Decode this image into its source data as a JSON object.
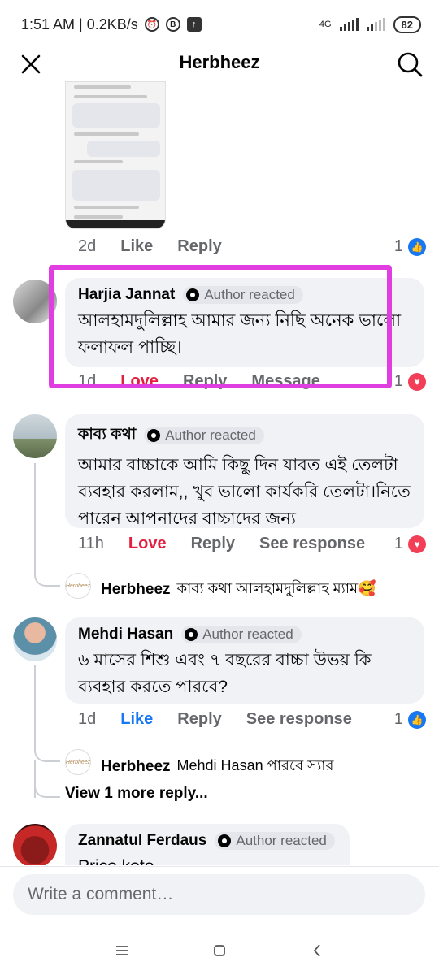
{
  "status_bar": {
    "time_speed": "1:51 AM | 0.2KB/s",
    "net": "4G",
    "battery": "82"
  },
  "header": {
    "title": "Herbheez"
  },
  "first_comment_meta": {
    "time": "2d",
    "like": "Like",
    "reply": "Reply",
    "react_count": "1"
  },
  "comments": [
    {
      "name": "Harjia Jannat",
      "badge": "Author reacted",
      "text": "আলহামদুলিল্লাহ আমার জন্য নিছি অনেক ভালো ফলাফল পাচ্ছি।",
      "time": "1d",
      "react_label": "Love",
      "reply": "Reply",
      "extra": "Message",
      "react_count": "1"
    },
    {
      "name": "কাব্য কথা",
      "badge": "Author reacted",
      "text": "আমার বাচ্চাকে আমি কিছু দিন যাবত এই তেলটা ব্যবহার করলাম,, খুব ভালো কার্যকরি তেলটা।নিতে পারেন আপনাদের বাচ্চাদের জন্য",
      "time": "11h",
      "react_label": "Love",
      "reply": "Reply",
      "extra": "See response",
      "react_count": "1",
      "page_reply": {
        "logo": "Herbheez",
        "name": "Herbheez",
        "text": "কাব্য কথা আলহামদুলিল্লাহ ম্যাম🥰"
      }
    },
    {
      "name": "Mehdi Hasan",
      "badge": "Author reacted",
      "text": "৬ মাসের শিশু এবং ৭ বছরের বাচ্চা উভয় কি ব্যবহার করতে পারবে?",
      "time": "1d",
      "react_label": "Like",
      "reply": "Reply",
      "extra": "See response",
      "react_count": "1",
      "page_reply": {
        "logo": "Herbheez",
        "name": "Herbheez",
        "text": "Mehdi Hasan পারবে স্যার"
      },
      "view_more": "View 1 more reply..."
    },
    {
      "name": "Zannatul Ferdaus",
      "badge": "Author reacted",
      "text": "Price koto"
    }
  ],
  "composer": {
    "placeholder": "Write a comment…"
  }
}
